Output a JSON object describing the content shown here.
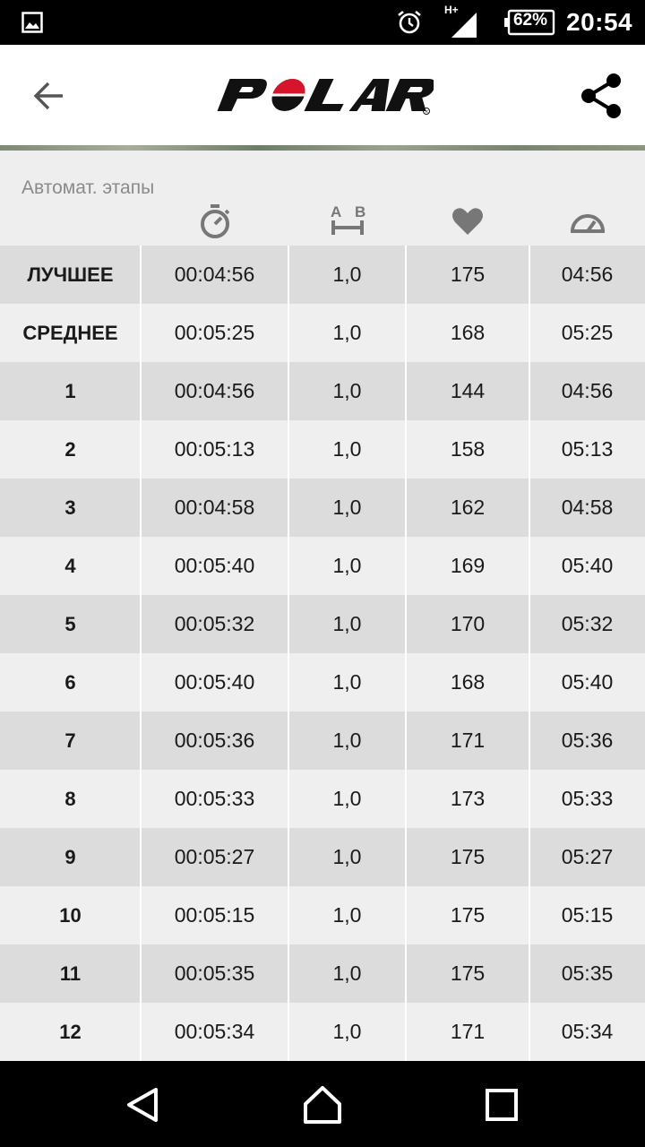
{
  "status_bar": {
    "network_label": "H+",
    "battery": "62%",
    "time": "20:54"
  },
  "app_bar": {
    "logo_text": "POLAR",
    "brand_color": "#d6142b"
  },
  "section": {
    "title": "Автомат. этапы"
  },
  "columns": [
    {
      "icon": "stopwatch-icon"
    },
    {
      "icon": "distance-icon",
      "label_a": "A",
      "label_b": "B"
    },
    {
      "icon": "heart-icon"
    },
    {
      "icon": "speedometer-icon"
    }
  ],
  "rows": [
    {
      "label": "ЛУЧШЕЕ",
      "time": "00:04:56",
      "distance": "1,0",
      "hr": "175",
      "pace": "04:56"
    },
    {
      "label": "СРЕДНЕЕ",
      "time": "00:05:25",
      "distance": "1,0",
      "hr": "168",
      "pace": "05:25"
    },
    {
      "label": "1",
      "time": "00:04:56",
      "distance": "1,0",
      "hr": "144",
      "pace": "04:56"
    },
    {
      "label": "2",
      "time": "00:05:13",
      "distance": "1,0",
      "hr": "158",
      "pace": "05:13"
    },
    {
      "label": "3",
      "time": "00:04:58",
      "distance": "1,0",
      "hr": "162",
      "pace": "04:58"
    },
    {
      "label": "4",
      "time": "00:05:40",
      "distance": "1,0",
      "hr": "169",
      "pace": "05:40"
    },
    {
      "label": "5",
      "time": "00:05:32",
      "distance": "1,0",
      "hr": "170",
      "pace": "05:32"
    },
    {
      "label": "6",
      "time": "00:05:40",
      "distance": "1,0",
      "hr": "168",
      "pace": "05:40"
    },
    {
      "label": "7",
      "time": "00:05:36",
      "distance": "1,0",
      "hr": "171",
      "pace": "05:36"
    },
    {
      "label": "8",
      "time": "00:05:33",
      "distance": "1,0",
      "hr": "173",
      "pace": "05:33"
    },
    {
      "label": "9",
      "time": "00:05:27",
      "distance": "1,0",
      "hr": "175",
      "pace": "05:27"
    },
    {
      "label": "10",
      "time": "00:05:15",
      "distance": "1,0",
      "hr": "175",
      "pace": "05:15"
    },
    {
      "label": "11",
      "time": "00:05:35",
      "distance": "1,0",
      "hr": "175",
      "pace": "05:35"
    },
    {
      "label": "12",
      "time": "00:05:34",
      "distance": "1,0",
      "hr": "171",
      "pace": "05:34"
    }
  ]
}
